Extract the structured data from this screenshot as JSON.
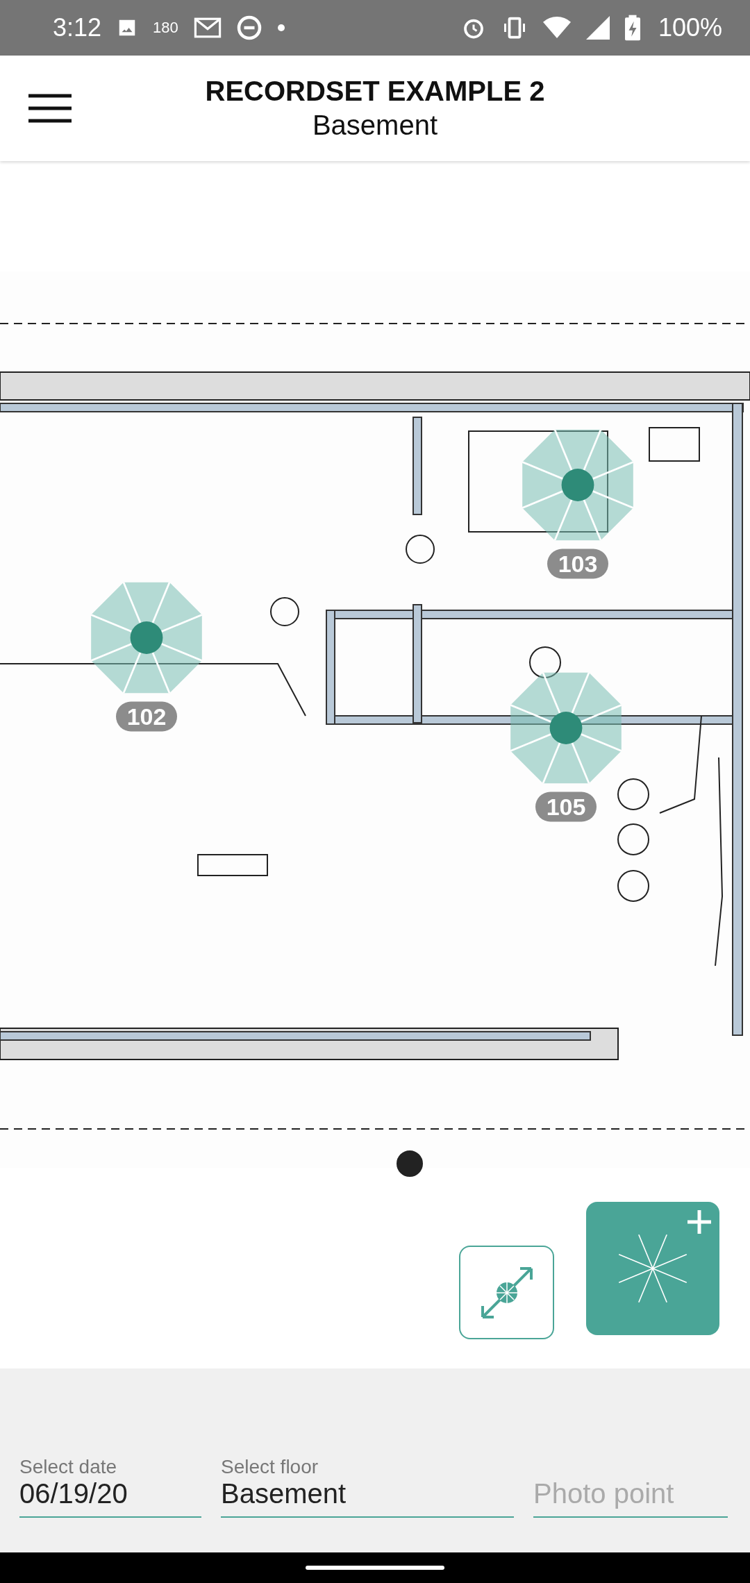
{
  "status_bar": {
    "time": "3:12",
    "notification_count": "180",
    "battery": "100%"
  },
  "header": {
    "title": "RECORDSET EXAMPLE 2",
    "subtitle": "Basement"
  },
  "plan": {
    "pins": [
      {
        "label": "103"
      },
      {
        "label": "102"
      },
      {
        "label": "105"
      }
    ]
  },
  "actions": [
    {
      "kind": "fit"
    },
    {
      "kind": "add"
    }
  ],
  "footer": {
    "fields": [
      {
        "label": "Select date",
        "value": "06/19/20"
      },
      {
        "label": "Select floor",
        "value": "Basement"
      },
      {
        "placeholder": "Photo point"
      }
    ]
  }
}
